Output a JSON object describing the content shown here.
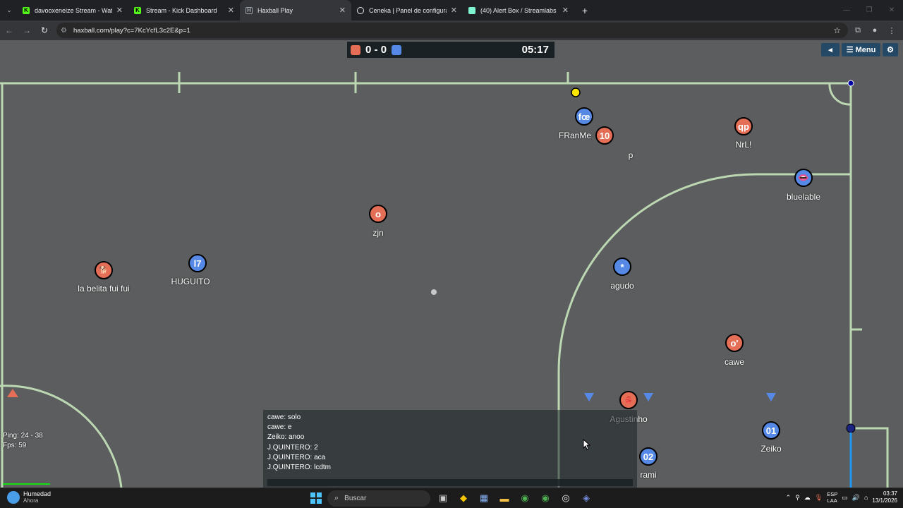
{
  "browser": {
    "tabs": [
      {
        "title": "davooxeneize Stream - Watch l",
        "icon": "kick-icon",
        "color": "#53fc18",
        "active": false
      },
      {
        "title": "Stream - Kick Dashboard",
        "icon": "kick-icon",
        "color": "#53fc18",
        "active": false
      },
      {
        "title": "Haxball Play",
        "icon": "haxball-icon",
        "color": "#9aa0a6",
        "active": true
      },
      {
        "title": "Ceneka | Panel de configuració",
        "icon": "globe-icon",
        "color": "#e8eaed",
        "active": false
      },
      {
        "title": "(40) Alert Box / Streamlabs",
        "icon": "streamlabs-icon",
        "color": "#80f5d2",
        "active": false
      }
    ],
    "new_tab": "+",
    "url": "haxball.com/play?c=7KcYcfL3c2E&p=1"
  },
  "game": {
    "red_score": "0",
    "separator": "-",
    "blue_score": "0",
    "clock": "05:17",
    "red_color": "#e56e56",
    "blue_color": "#5689e5",
    "menu_label": "Menu",
    "players": [
      {
        "team": "blue",
        "avatar": "fœ",
        "name": "FRanMe"
      },
      {
        "team": "red",
        "avatar": "10",
        "name": ""
      },
      {
        "team": "red",
        "avatar": "qp",
        "name": "NrL!"
      },
      {
        "team": "blue",
        "avatar": "👄",
        "name": "bluelable"
      },
      {
        "team": "red",
        "avatar": "o",
        "name": "zjn"
      },
      {
        "team": "red",
        "avatar": "🐕",
        "name": "la belita fui fui"
      },
      {
        "team": "blue",
        "avatar": "l7",
        "name": "HUGUITO"
      },
      {
        "team": "blue",
        "avatar": "*",
        "name": "agudo"
      },
      {
        "team": "red",
        "avatar": "o'",
        "name": "cawe"
      },
      {
        "team": "red",
        "avatar": "👙",
        "name": "Agustinho"
      },
      {
        "team": "blue",
        "avatar": "01",
        "name": "Zeiko"
      },
      {
        "team": "blue",
        "avatar": "02",
        "name": "rami"
      }
    ],
    "stray_text": "p",
    "ping": "Ping: 24 - 38",
    "fps": "Fps: 59",
    "chat": [
      "cawe: solo",
      "cawe: e",
      "Zeiko: anoo",
      "J.QUINTERO: 2",
      "J.QUINTERO: aca",
      "J.QUINTERO: lcdtm"
    ]
  },
  "taskbar": {
    "weather_title": "Humedad",
    "weather_sub": "Ahora",
    "search": "Buscar",
    "lang_1": "ESP",
    "lang_2": "LAA",
    "time": "03:37",
    "date": "13/1/2026"
  }
}
